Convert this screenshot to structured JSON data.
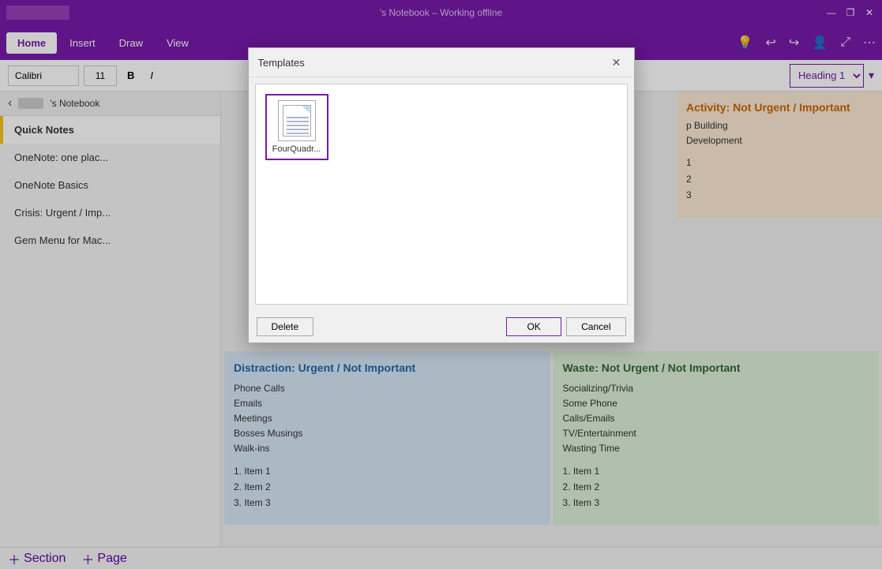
{
  "titlebar": {
    "title": "'s Notebook – Working offline",
    "minimize": "—",
    "restore": "❐",
    "close": "✕"
  },
  "ribbon": {
    "tabs": [
      "Home",
      "Insert",
      "Draw",
      "View"
    ],
    "active_tab": "Home",
    "icons": [
      "💡",
      "↩",
      "↪",
      "👤",
      "⤢",
      "⋯"
    ]
  },
  "formatbar": {
    "font_name": "Calibri",
    "font_size": "11",
    "bold": "B",
    "italic": "I",
    "heading": "Heading 1"
  },
  "sidebar": {
    "notebook_name": "'s Notebook",
    "items": [
      {
        "label": "Quick Notes",
        "active": true
      },
      {
        "label": "OneNote: one plac...",
        "active": false
      },
      {
        "label": "OneNote Basics",
        "active": false
      },
      {
        "label": "Crisis: Urgent / Imp...",
        "active": false
      },
      {
        "label": "Gem Menu for Mac...",
        "active": false
      }
    ]
  },
  "content": {
    "quadrants": [
      {
        "id": "q2",
        "title": "Activity: Not Urgent / Important",
        "color": "orange",
        "items": [
          "p Building",
          "Development"
        ],
        "list": [
          "1",
          "2",
          "3"
        ]
      },
      {
        "id": "q3",
        "title": "Distraction: Urgent / Not Important",
        "color": "blue",
        "items": [
          "Phone Calls",
          "Emails",
          "Meetings",
          "Bosses Musings",
          "Walk-ins"
        ],
        "list": [
          "Item 1",
          "Item 2",
          "Item 3"
        ]
      },
      {
        "id": "q4",
        "title": "Waste: Not Urgent / Not Important",
        "color": "green",
        "items": [
          "Socializing/Trivia",
          "Some Phone",
          "Calls/Emails",
          "TV/Entertainment",
          "Wasting Time"
        ],
        "list": [
          "Item 1",
          "Item 2",
          "Item 3"
        ]
      }
    ]
  },
  "bottombar": {
    "section_label": "Section",
    "page_label": "Page"
  },
  "dialog": {
    "title": "Templates",
    "template_name": "FourQuadr...",
    "delete_btn": "Delete",
    "ok_btn": "OK",
    "cancel_btn": "Cancel"
  }
}
